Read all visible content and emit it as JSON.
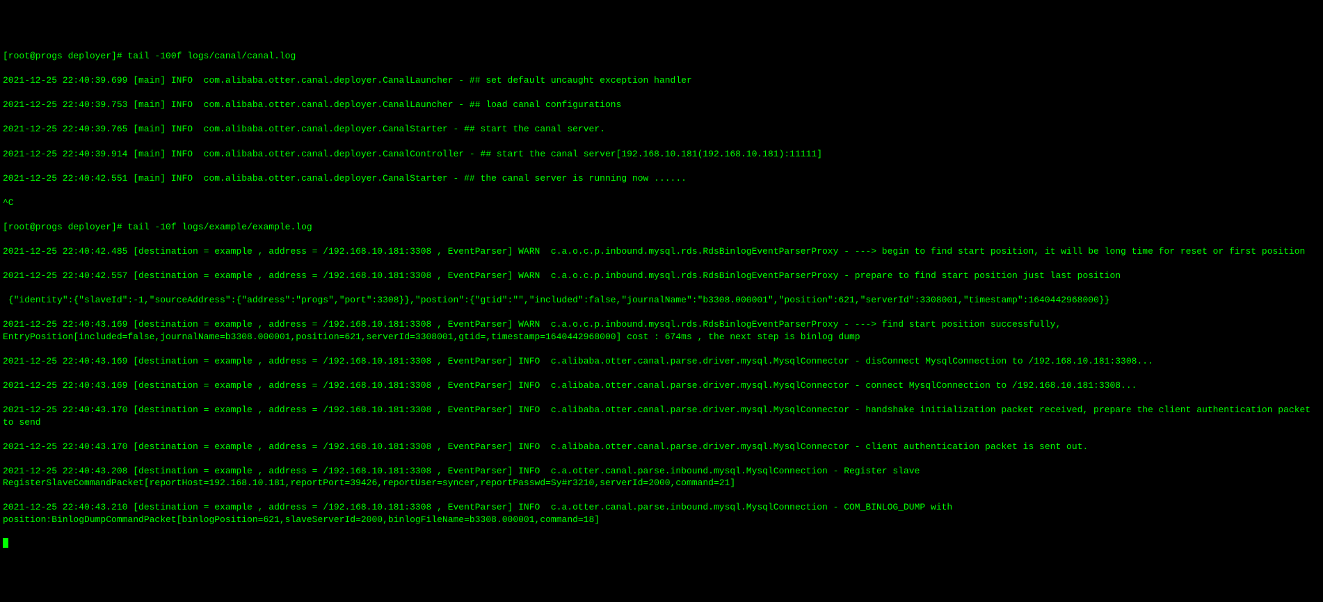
{
  "prompt1": "[root@progs deployer]# tail -100f logs/canal/canal.log",
  "log_lines_canal": [
    "2021-12-25 22:40:39.699 [main] INFO  com.alibaba.otter.canal.deployer.CanalLauncher - ## set default uncaught exception handler",
    "2021-12-25 22:40:39.753 [main] INFO  com.alibaba.otter.canal.deployer.CanalLauncher - ## load canal configurations",
    "2021-12-25 22:40:39.765 [main] INFO  com.alibaba.otter.canal.deployer.CanalStarter - ## start the canal server.",
    "2021-12-25 22:40:39.914 [main] INFO  com.alibaba.otter.canal.deployer.CanalController - ## start the canal server[192.168.10.181(192.168.10.181):11111]",
    "2021-12-25 22:40:42.551 [main] INFO  com.alibaba.otter.canal.deployer.CanalStarter - ## the canal server is running now ......"
  ],
  "ctrl_c": "^C",
  "prompt2": "[root@progs deployer]# tail -10f logs/example/example.log",
  "log_lines_example": [
    "2021-12-25 22:40:42.485 [destination = example , address = /192.168.10.181:3308 , EventParser] WARN  c.a.o.c.p.inbound.mysql.rds.RdsBinlogEventParserProxy - ---> begin to find start position, it will be long time for reset or first position",
    "2021-12-25 22:40:42.557 [destination = example , address = /192.168.10.181:3308 , EventParser] WARN  c.a.o.c.p.inbound.mysql.rds.RdsBinlogEventParserProxy - prepare to find start position just last position",
    " {\"identity\":{\"slaveId\":-1,\"sourceAddress\":{\"address\":\"progs\",\"port\":3308}},\"postion\":{\"gtid\":\"\",\"included\":false,\"journalName\":\"b3308.000001\",\"position\":621,\"serverId\":3308001,\"timestamp\":1640442968000}}",
    "2021-12-25 22:40:43.169 [destination = example , address = /192.168.10.181:3308 , EventParser] WARN  c.a.o.c.p.inbound.mysql.rds.RdsBinlogEventParserProxy - ---> find start position successfully, EntryPosition[included=false,journalName=b3308.000001,position=621,serverId=3308001,gtid=,timestamp=1640442968000] cost : 674ms , the next step is binlog dump",
    "2021-12-25 22:40:43.169 [destination = example , address = /192.168.10.181:3308 , EventParser] INFO  c.alibaba.otter.canal.parse.driver.mysql.MysqlConnector - disConnect MysqlConnection to /192.168.10.181:3308...",
    "2021-12-25 22:40:43.169 [destination = example , address = /192.168.10.181:3308 , EventParser] INFO  c.alibaba.otter.canal.parse.driver.mysql.MysqlConnector - connect MysqlConnection to /192.168.10.181:3308...",
    "2021-12-25 22:40:43.170 [destination = example , address = /192.168.10.181:3308 , EventParser] INFO  c.alibaba.otter.canal.parse.driver.mysql.MysqlConnector - handshake initialization packet received, prepare the client authentication packet to send",
    "2021-12-25 22:40:43.170 [destination = example , address = /192.168.10.181:3308 , EventParser] INFO  c.alibaba.otter.canal.parse.driver.mysql.MysqlConnector - client authentication packet is sent out.",
    "2021-12-25 22:40:43.208 [destination = example , address = /192.168.10.181:3308 , EventParser] INFO  c.a.otter.canal.parse.inbound.mysql.MysqlConnection - Register slave RegisterSlaveCommandPacket[reportHost=192.168.10.181,reportPort=39426,reportUser=syncer,reportPasswd=Sy#r3210,serverId=2000,command=21]",
    "2021-12-25 22:40:43.210 [destination = example , address = /192.168.10.181:3308 , EventParser] INFO  c.a.otter.canal.parse.inbound.mysql.MysqlConnection - COM_BINLOG_DUMP with position:BinlogDumpCommandPacket[binlogPosition=621,slaveServerId=2000,binlogFileName=b3308.000001,command=18]"
  ]
}
